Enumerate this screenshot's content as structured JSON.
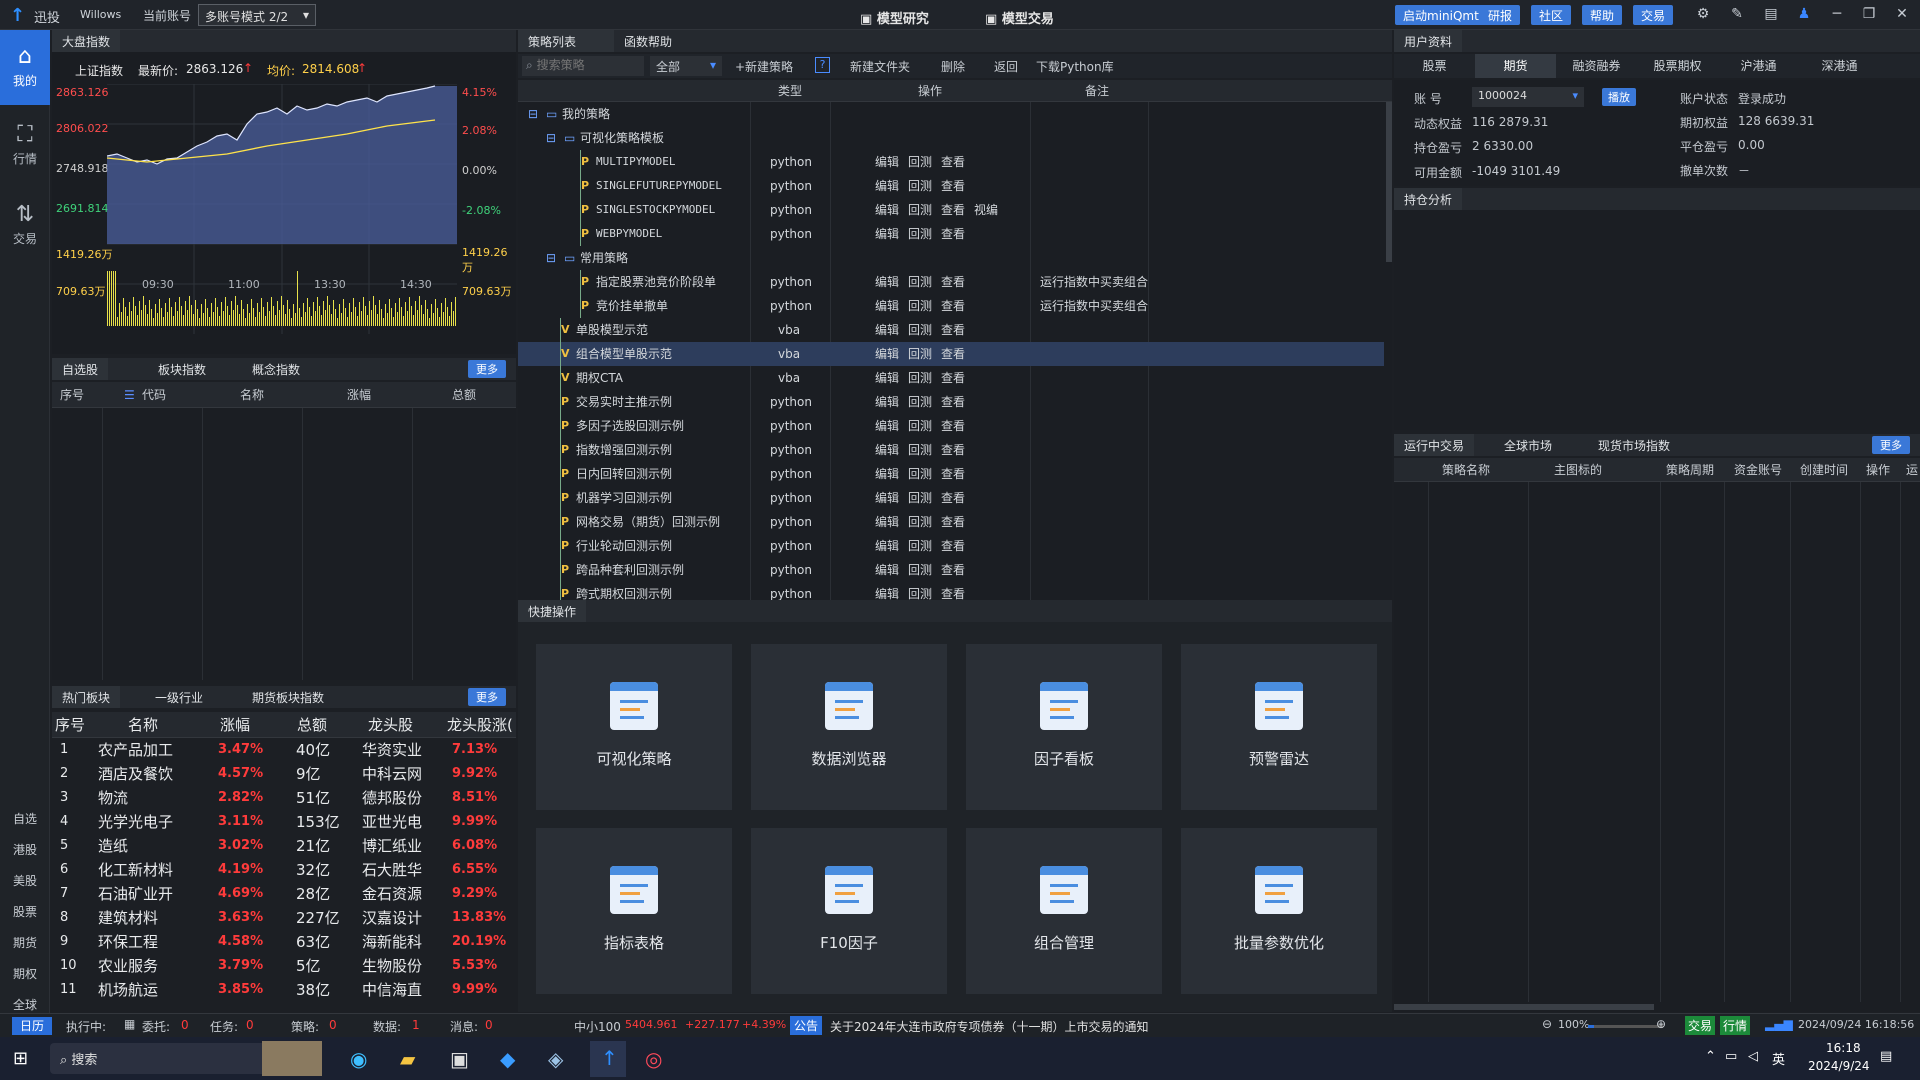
{
  "titlebar": {
    "app": "迅投",
    "user": "Willows",
    "account_label": "当前账号",
    "mode_select": "多账号模式 2/2",
    "center_tabs": [
      "模型研究",
      "模型交易"
    ],
    "right_buttons": [
      "启动miniQmt",
      "研报",
      "社区",
      "帮助",
      "交易"
    ]
  },
  "leftnav": {
    "items": [
      {
        "label": "我的",
        "icon": "home-icon",
        "active": true
      },
      {
        "label": "行情",
        "icon": "chart-icon",
        "active": false
      },
      {
        "label": "交易",
        "icon": "trade-icon",
        "active": false
      }
    ],
    "bottom_items": [
      "自选",
      "港股",
      "美股",
      "股票",
      "期货",
      "期权",
      "全球"
    ]
  },
  "market": {
    "tab": "大盘指数",
    "index_name": "上证指数",
    "last_label": "最新价:",
    "last_value": "2863.126",
    "avg_label": "均价:",
    "avg_value": "2814.608",
    "y_left": [
      "2863.126",
      "2806.022",
      "2748.918",
      "2691.814"
    ],
    "y_right": [
      "4.15%",
      "2.08%",
      "0.00%",
      "-2.08%"
    ],
    "vol_left": [
      "1419.26万",
      "709.63万"
    ],
    "vol_right": [
      "1419.26万",
      "709.63万"
    ],
    "x_ticks": [
      "09:30",
      "11:00",
      "13:30",
      "14:30"
    ]
  },
  "watch": {
    "tabs": [
      "自选股",
      "板块指数",
      "概念指数"
    ],
    "more": "更多",
    "headers": [
      "序号",
      "代码",
      "名称",
      "涨幅",
      "总额"
    ]
  },
  "hot": {
    "tabs": [
      "热门板块",
      "一级行业",
      "期货板块指数"
    ],
    "more": "更多",
    "headers": [
      "序号",
      "名称",
      "涨幅",
      "总额",
      "龙头股",
      "龙头股涨("
    ],
    "rows": [
      [
        "1",
        "农产品加工",
        "3.47%",
        "40亿",
        "华资实业",
        "7.13%"
      ],
      [
        "2",
        "酒店及餐饮",
        "4.57%",
        "9亿",
        "中科云网",
        "9.92%"
      ],
      [
        "3",
        "物流",
        "2.82%",
        "51亿",
        "德邦股份",
        "8.51%"
      ],
      [
        "4",
        "光学光电子",
        "3.11%",
        "153亿",
        "亚世光电",
        "9.99%"
      ],
      [
        "5",
        "造纸",
        "3.02%",
        "21亿",
        "博汇纸业",
        "6.08%"
      ],
      [
        "6",
        "化工新材料",
        "4.19%",
        "32亿",
        "石大胜华",
        "6.55%"
      ],
      [
        "7",
        "石油矿业开",
        "4.69%",
        "28亿",
        "金石资源",
        "9.29%"
      ],
      [
        "8",
        "建筑材料",
        "3.63%",
        "227亿",
        "汉嘉设计",
        "13.83%"
      ],
      [
        "9",
        "环保工程",
        "4.58%",
        "63亿",
        "海新能科",
        "20.19%"
      ],
      [
        "10",
        "农业服务",
        "3.79%",
        "5亿",
        "生物股份",
        "5.53%"
      ],
      [
        "11",
        "机场航运",
        "3.85%",
        "38亿",
        "中信海直",
        "9.99%"
      ]
    ]
  },
  "strategy": {
    "tabs": [
      "策略列表",
      "函数帮助"
    ],
    "search_placeholder": "搜索策略",
    "filter": "全部",
    "actions": [
      "+新建策略",
      "新建文件夹",
      "删除",
      "返回",
      "下载Python库"
    ],
    "help_badge": "?",
    "headers": [
      "类型",
      "操作",
      "备注"
    ],
    "rows": [
      {
        "level": 0,
        "kind": "folder",
        "toggle": "⊟",
        "name": "我的策略",
        "type": "",
        "ops": [],
        "note": ""
      },
      {
        "level": 1,
        "kind": "folder",
        "toggle": "⊟",
        "name": "可视化策略模板",
        "type": "",
        "ops": [],
        "note": ""
      },
      {
        "level": 2,
        "kind": "P",
        "toggle": "",
        "name": "MULTIPYMODEL",
        "type": "python",
        "ops": [
          "编辑",
          "回测",
          "查看"
        ],
        "note": ""
      },
      {
        "level": 2,
        "kind": "P",
        "toggle": "",
        "name": "SINGLEFUTUREPYMODEL",
        "type": "python",
        "ops": [
          "编辑",
          "回测",
          "查看"
        ],
        "note": ""
      },
      {
        "level": 2,
        "kind": "P",
        "toggle": "",
        "name": "SINGLESTOCKPYMODEL",
        "type": "python",
        "ops": [
          "编辑",
          "回测",
          "查看",
          "视编"
        ],
        "note": ""
      },
      {
        "level": 2,
        "kind": "P",
        "toggle": "",
        "name": "WEBPYMODEL",
        "type": "python",
        "ops": [
          "编辑",
          "回测",
          "查看"
        ],
        "note": ""
      },
      {
        "level": 1,
        "kind": "folder",
        "toggle": "⊟",
        "name": "常用策略",
        "type": "",
        "ops": [],
        "note": ""
      },
      {
        "level": 2,
        "kind": "P",
        "toggle": "",
        "name": "指定股票池竞价阶段单",
        "type": "python",
        "ops": [
          "编辑",
          "回测",
          "查看"
        ],
        "note": "运行指数中买卖组合"
      },
      {
        "level": 2,
        "kind": "P",
        "toggle": "",
        "name": "竞价挂单撤单",
        "type": "python",
        "ops": [
          "编辑",
          "回测",
          "查看"
        ],
        "note": "运行指数中买卖组合"
      },
      {
        "level": 1,
        "kind": "V",
        "toggle": "",
        "name": "单股模型示范",
        "type": "vba",
        "ops": [
          "编辑",
          "回测",
          "查看"
        ],
        "note": ""
      },
      {
        "level": 1,
        "kind": "V",
        "toggle": "",
        "name": "组合模型单股示范",
        "type": "vba",
        "ops": [
          "编辑",
          "回测",
          "查看"
        ],
        "note": "",
        "selected": true
      },
      {
        "level": 1,
        "kind": "V",
        "toggle": "",
        "name": "期权CTA",
        "type": "vba",
        "ops": [
          "编辑",
          "回测",
          "查看"
        ],
        "note": ""
      },
      {
        "level": 1,
        "kind": "P",
        "toggle": "",
        "name": "交易实时主推示例",
        "type": "python",
        "ops": [
          "编辑",
          "回测",
          "查看"
        ],
        "note": ""
      },
      {
        "level": 1,
        "kind": "P",
        "toggle": "",
        "name": "多因子选股回测示例",
        "type": "python",
        "ops": [
          "编辑",
          "回测",
          "查看"
        ],
        "note": ""
      },
      {
        "level": 1,
        "kind": "P",
        "toggle": "",
        "name": "指数增强回测示例",
        "type": "python",
        "ops": [
          "编辑",
          "回测",
          "查看"
        ],
        "note": ""
      },
      {
        "level": 1,
        "kind": "P",
        "toggle": "",
        "name": "日内回转回测示例",
        "type": "python",
        "ops": [
          "编辑",
          "回测",
          "查看"
        ],
        "note": ""
      },
      {
        "level": 1,
        "kind": "P",
        "toggle": "",
        "name": "机器学习回测示例",
        "type": "python",
        "ops": [
          "编辑",
          "回测",
          "查看"
        ],
        "note": ""
      },
      {
        "level": 1,
        "kind": "P",
        "toggle": "",
        "name": "网格交易（期货）回测示例",
        "type": "python",
        "ops": [
          "编辑",
          "回测",
          "查看"
        ],
        "note": ""
      },
      {
        "level": 1,
        "kind": "P",
        "toggle": "",
        "name": "行业轮动回测示例",
        "type": "python",
        "ops": [
          "编辑",
          "回测",
          "查看"
        ],
        "note": ""
      },
      {
        "level": 1,
        "kind": "P",
        "toggle": "",
        "name": "跨品种套利回测示例",
        "type": "python",
        "ops": [
          "编辑",
          "回测",
          "查看"
        ],
        "note": ""
      },
      {
        "level": 1,
        "kind": "P",
        "toggle": "",
        "name": "跨式期权回测示例",
        "type": "python",
        "ops": [
          "编辑",
          "回测",
          "查看"
        ],
        "note": ""
      }
    ]
  },
  "quick": {
    "title": "快捷操作",
    "tiles": [
      "可视化策略",
      "数据浏览器",
      "因子看板",
      "预警雷达",
      "指标表格",
      "F10因子",
      "组合管理",
      "批量参数优化"
    ]
  },
  "user": {
    "title": "用户资料",
    "tabs": [
      "股票",
      "期货",
      "融资融券",
      "股票期权",
      "沪港通",
      "深港通"
    ],
    "account_label": "账  号",
    "account_value": "1000024",
    "switch_btn": "播放",
    "fields_left": [
      [
        "动态权益",
        "116 2879.31"
      ],
      [
        "持仓盈亏",
        "2 6330.00"
      ],
      [
        "可用金额",
        "-1049 3101.49"
      ]
    ],
    "fields_right": [
      [
        "账户状态",
        "登录成功"
      ],
      [
        "期初权益",
        "128 6639.31"
      ],
      [
        "平仓盈亏",
        "0.00"
      ],
      [
        "撤单次数",
        "－"
      ]
    ],
    "position_tab": "持仓分析"
  },
  "running": {
    "tabs": [
      "运行中交易",
      "全球市场",
      "现货市场指数"
    ],
    "more": "更多",
    "headers": [
      "策略名称",
      "主图标的",
      "策略周期",
      "资金账号",
      "创建时间",
      "操作",
      "运"
    ]
  },
  "statusbar": {
    "date_btn": "日历",
    "running": "执行中:",
    "entrust": "委托:",
    "entrust_n": "0",
    "task": "任务:",
    "task_n": "0",
    "strategy": "策略:",
    "strategy_n": "0",
    "data": "数据:",
    "data_n": "1",
    "msg": "消息:",
    "msg_n": "0",
    "index_name": "中小100",
    "index_val": "5404.961",
    "index_chg": "+227.177",
    "index_pct": "+4.39%",
    "notice_tag": "公告",
    "notice": "关于2024年大连市政府专项债券（十一期）上市交易的通知",
    "zoom": "100%",
    "trade": "交易",
    "quote": "行情",
    "datetime": "2024/09/24 16:18:56"
  },
  "taskbar": {
    "search": "搜索",
    "tray_lang": "英",
    "time": "16:18",
    "date": "2024/9/24"
  }
}
